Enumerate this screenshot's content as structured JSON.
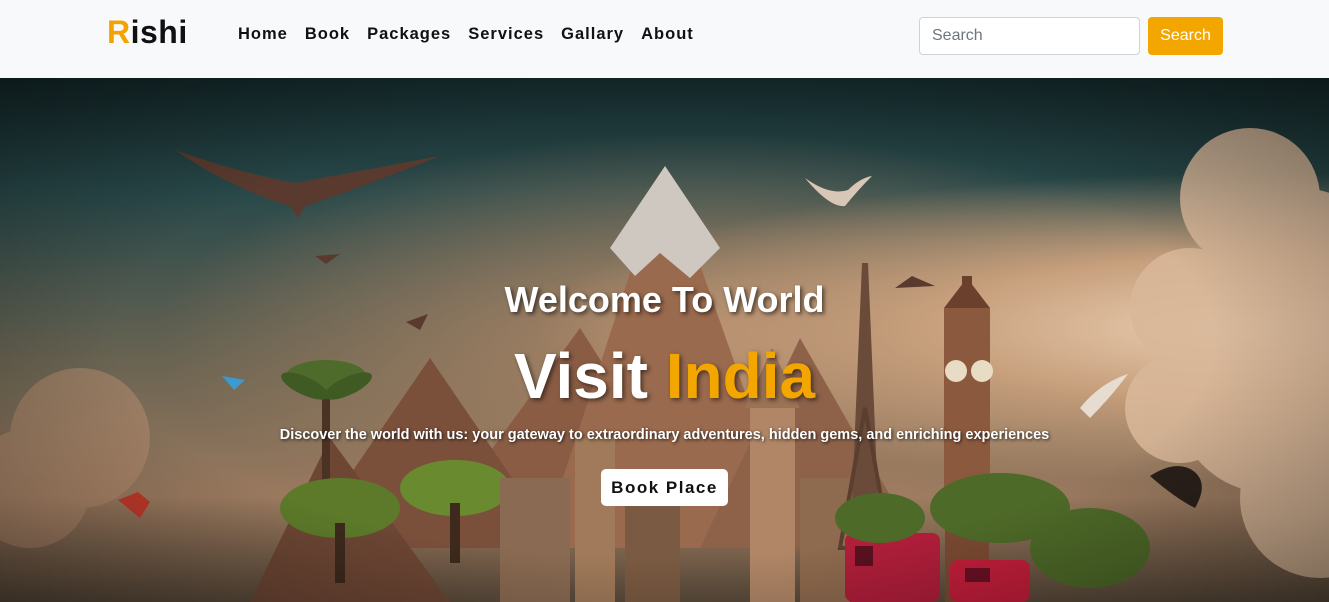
{
  "brand": {
    "first_letter": "R",
    "rest": "ishi"
  },
  "nav": {
    "links": [
      "Home",
      "Book",
      "Packages",
      "Services",
      "Gallary",
      "About"
    ]
  },
  "search": {
    "placeholder": "Search",
    "button_label": "Search"
  },
  "hero": {
    "welcome": "Welcome To World",
    "visit_prefix": "Visit",
    "visit_accent": "India",
    "tagline": "Discover the world with us: your gateway to extraordinary adventures, hidden gems, and enriching experiences",
    "cta_label": "Book Place"
  },
  "colors": {
    "accent": "#f4a600",
    "navbar_bg": "#f8f9fa",
    "text_dark": "#111111"
  }
}
